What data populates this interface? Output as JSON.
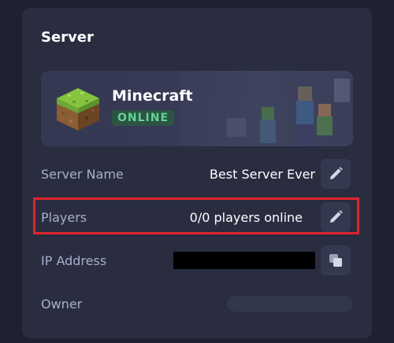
{
  "card": {
    "title": "Server"
  },
  "game": {
    "name": "Minecraft",
    "status": "ONLINE"
  },
  "rows": {
    "server_name": {
      "label": "Server Name",
      "value": "Best Server Ever",
      "action_icon": "pencil-icon"
    },
    "players": {
      "label": "Players",
      "value": "0/0 players online",
      "action_icon": "pencil-icon"
    },
    "ip_address": {
      "label": "IP Address",
      "action_icon": "copy-icon"
    },
    "owner": {
      "label": "Owner"
    }
  },
  "colors": {
    "background": "#1f2130",
    "card": "#2a2d40",
    "label": "#a9aecb",
    "status_text": "#5fd494",
    "status_bg": "#2c5442",
    "highlight": "#e0242d"
  }
}
